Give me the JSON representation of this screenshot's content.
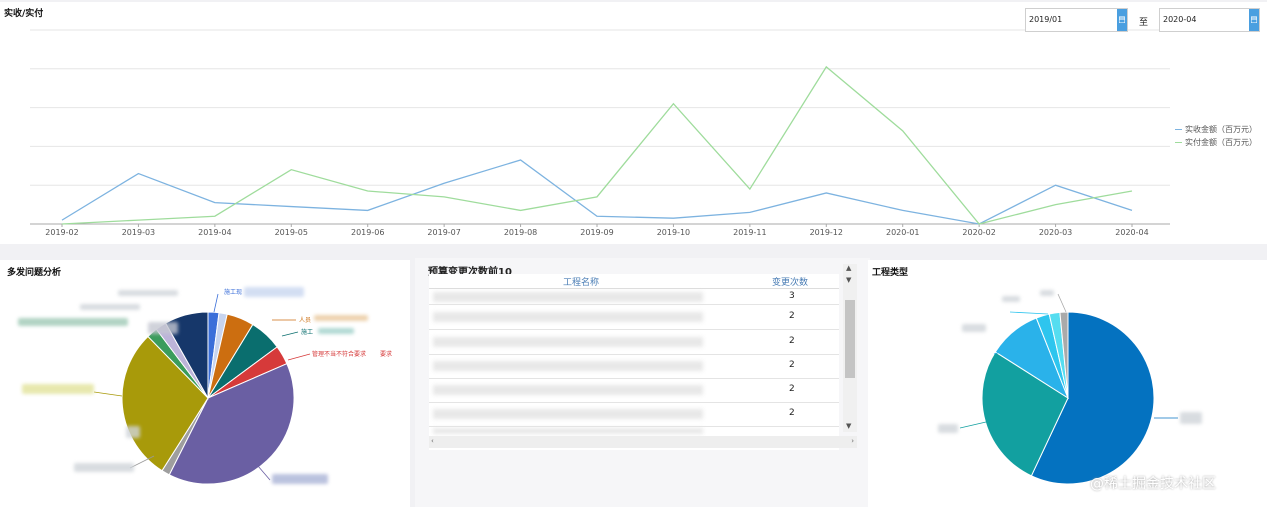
{
  "top_chart": {
    "title": "实收/实付",
    "date_from": "2019/01",
    "date_sep": "至",
    "date_to": "2020-04",
    "icon": "calendar-icon"
  },
  "chart_data": [
    {
      "type": "line",
      "x": [
        "2019-02",
        "2019-03",
        "2019-04",
        "2019-05",
        "2019-06",
        "2019-07",
        "2019-08",
        "2019-09",
        "2019-10",
        "2019-11",
        "2019-12",
        "2020-01",
        "2020-02",
        "2020-03",
        "2020-04"
      ],
      "ylim": [
        0,
        5
      ],
      "grid": true,
      "legend_position": "right",
      "series": [
        {
          "name": "实收金额（百万元）",
          "color": "#7db3e0",
          "values": [
            0.1,
            1.3,
            0.55,
            0.45,
            0.35,
            1.05,
            1.65,
            0.2,
            0.15,
            0.3,
            0.8,
            0.35,
            0.0,
            1.0,
            0.35
          ]
        },
        {
          "name": "实付金额（百万元）",
          "color": "#9fdc9c",
          "values": [
            0.0,
            0.1,
            0.2,
            1.4,
            0.85,
            0.7,
            0.35,
            0.7,
            3.1,
            0.9,
            4.05,
            2.4,
            0.0,
            0.5,
            0.85
          ]
        }
      ]
    },
    {
      "type": "pie",
      "colors": [
        "#3b6fd9",
        "#c7d4ef",
        "#cc6e10",
        "#0a6e6e",
        "#d63a3a",
        "#6a5fa3",
        "#9e9e9e",
        "#a89a0a",
        "#3b9c5c",
        "#bcb4d9",
        "#16376a"
      ],
      "values": [
        2,
        1.5,
        5,
        6,
        3.5,
        38,
        1.5,
        28,
        2,
        2,
        8
      ]
    },
    {
      "type": "pie",
      "colors": [
        "#0472c0",
        "#12a0a0",
        "#2ab2ea",
        "#2ec5ee",
        "#55ddf0",
        "#aaaaaa"
      ],
      "values": [
        57,
        27,
        10,
        2.5,
        2,
        1.5
      ]
    }
  ],
  "left_pie": {
    "title": "多发问题分析",
    "labels": [
      "施工现",
      "施工",
      "人员",
      "要求",
      "管理不当不符合要求"
    ]
  },
  "table": {
    "title": "预算变更次数前10",
    "col_name": "工程名称",
    "col_count": "变更次数",
    "rows": [
      {
        "count": "3"
      },
      {
        "count": "2"
      },
      {
        "count": "2"
      },
      {
        "count": "2"
      },
      {
        "count": "2"
      },
      {
        "count": "2"
      }
    ]
  },
  "right_pie": {
    "title": "工程类型"
  },
  "watermark": "@稀土掘金技术社区"
}
